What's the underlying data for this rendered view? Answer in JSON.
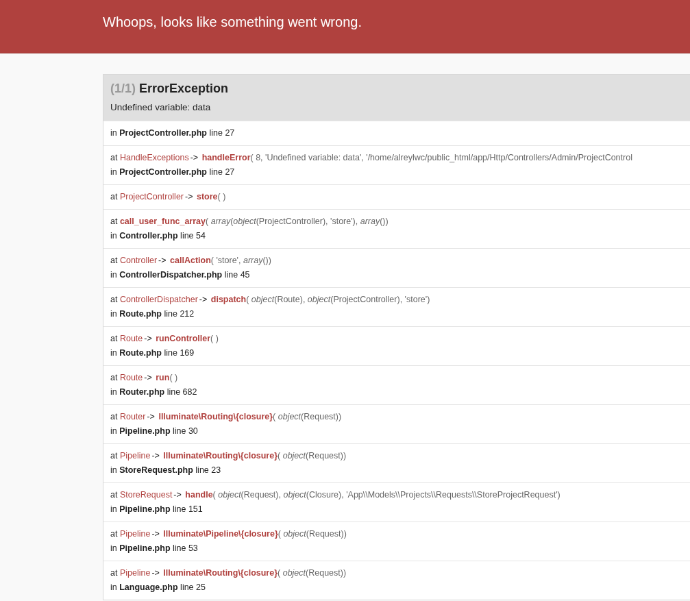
{
  "header": {
    "title": "Whoops, looks like something went wrong."
  },
  "exception": {
    "count": "(1/1)",
    "name": "ErrorException",
    "message": "Undefined variable: data"
  },
  "trace": [
    {
      "location": "in **ProjectController.php** line 27"
    },
    {
      "call": {
        "at": "at",
        "class": "HandleExceptions",
        "arrow": "->",
        "method": "handleError",
        "args": "( 8, 'Undefined variable: data', '/home/alreylwc/public_html/app/Http/Controllers/Admin/ProjectControl"
      },
      "location": "in **ProjectController.php** line 27"
    },
    {
      "call": {
        "at": "at",
        "class": "ProjectController",
        "arrow": "->",
        "method": "store",
        "args": "( )"
      }
    },
    {
      "call": {
        "at": "at",
        "method": "call_user_func_array",
        "args": "( *array*(*object*(ProjectController), 'store'), *array*())"
      },
      "location": "in **Controller.php** line 54"
    },
    {
      "call": {
        "at": "at",
        "class": "Controller",
        "arrow": "->",
        "method": "callAction",
        "args": "( 'store', *array*())"
      },
      "location": "in **ControllerDispatcher.php** line 45"
    },
    {
      "call": {
        "at": "at",
        "class": "ControllerDispatcher",
        "arrow": "->",
        "method": "dispatch",
        "args": "( *object*(Route), *object*(ProjectController), 'store')"
      },
      "location": "in **Route.php** line 212"
    },
    {
      "call": {
        "at": "at",
        "class": "Route",
        "arrow": "->",
        "method": "runController",
        "args": "( )"
      },
      "location": "in **Route.php** line 169"
    },
    {
      "call": {
        "at": "at",
        "class": "Route",
        "arrow": "->",
        "method": "run",
        "args": "( )"
      },
      "location": "in **Router.php** line 682"
    },
    {
      "call": {
        "at": "at",
        "class": "Router",
        "arrow": "->",
        "method": "Illuminate\\Routing\\{closure}",
        "args": "( *object*(Request))"
      },
      "location": "in **Pipeline.php** line 30"
    },
    {
      "call": {
        "at": "at",
        "class": "Pipeline",
        "arrow": "->",
        "method": "Illuminate\\Routing\\{closure}",
        "args": "( *object*(Request))"
      },
      "location": "in **StoreRequest.php** line 23"
    },
    {
      "call": {
        "at": "at",
        "class": "StoreRequest",
        "arrow": "->",
        "method": "handle",
        "args": "( *object*(Request), *object*(Closure), 'App\\\\Models\\\\Projects\\\\Requests\\\\StoreProjectRequest')"
      },
      "location": "in **Pipeline.php** line 151"
    },
    {
      "call": {
        "at": "at",
        "class": "Pipeline",
        "arrow": "->",
        "method": "Illuminate\\Pipeline\\{closure}",
        "args": "( *object*(Request))"
      },
      "location": "in **Pipeline.php** line 53"
    },
    {
      "call": {
        "at": "at",
        "class": "Pipeline",
        "arrow": "->",
        "method": "Illuminate\\Routing\\{closure}",
        "args": "( *object*(Request))"
      },
      "location": "in **Language.php** line 25"
    }
  ]
}
